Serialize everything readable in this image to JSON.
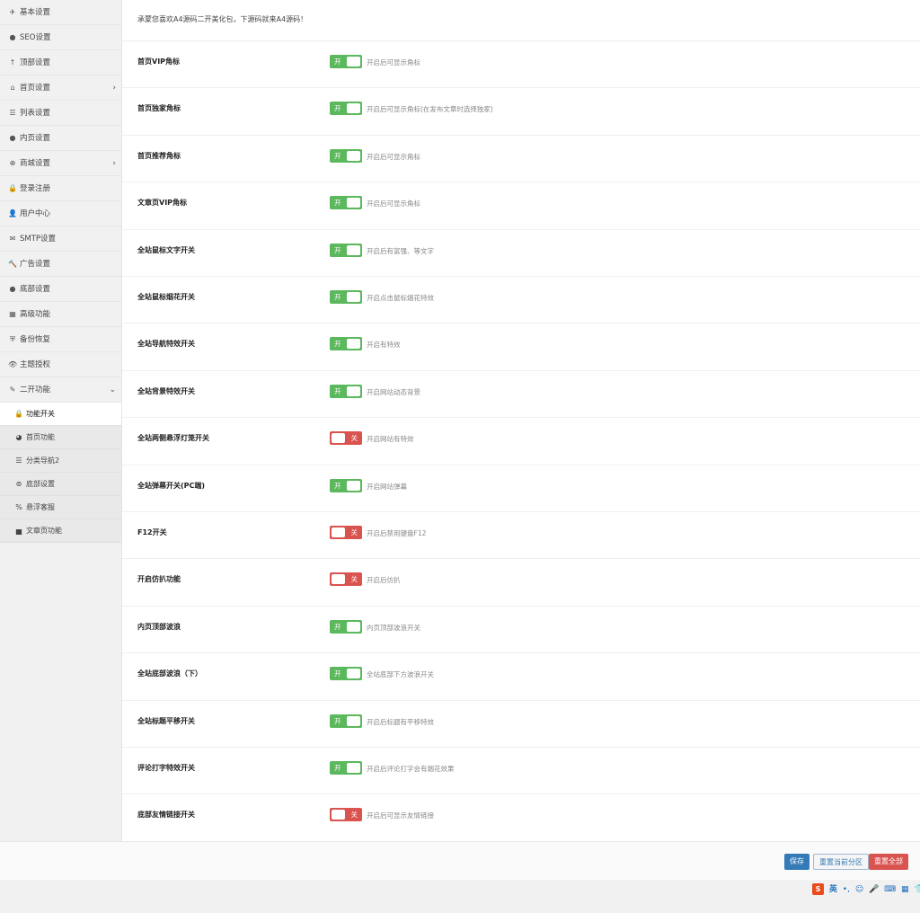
{
  "sidebar": {
    "items": [
      {
        "label": "基本设置",
        "icon": "✈"
      },
      {
        "label": "SEO设置",
        "icon": "●"
      },
      {
        "label": "顶部设置",
        "icon": "↑"
      },
      {
        "label": "首页设置",
        "icon": "⌂",
        "chevron": "›"
      },
      {
        "label": "列表设置",
        "icon": "☰"
      },
      {
        "label": "内页设置",
        "icon": "●"
      },
      {
        "label": "商城设置",
        "icon": "⊕",
        "chevron": "›"
      },
      {
        "label": "登录注册",
        "icon": "🔒"
      },
      {
        "label": "用户中心",
        "icon": "👤"
      },
      {
        "label": "SMTP设置",
        "icon": "✉"
      },
      {
        "label": "广告设置",
        "icon": "🔨"
      },
      {
        "label": "底部设置",
        "icon": "●"
      },
      {
        "label": "高级功能",
        "icon": "▦"
      },
      {
        "label": "备份恢复",
        "icon": "⛨"
      },
      {
        "label": "主题授权",
        "icon": "👁"
      },
      {
        "label": "二开功能",
        "icon": "✎",
        "chevron": "⌄"
      }
    ],
    "sub_items": [
      {
        "label": "功能开关",
        "icon": "🔒"
      },
      {
        "label": "首页功能",
        "icon": "◕"
      },
      {
        "label": "分类导航2",
        "icon": "☰"
      },
      {
        "label": "底部设置",
        "icon": "⊚"
      },
      {
        "label": "悬浮客服",
        "icon": "%"
      },
      {
        "label": "文章页功能",
        "icon": "▅"
      }
    ]
  },
  "main": {
    "welcome": "承蒙您喜欢A4源码二开美化包，下源码就来A4源码！",
    "rows": [
      {
        "label": "首页VIP角标",
        "state": "开",
        "desc": "开启后可显示角标"
      },
      {
        "label": "首页独家角标",
        "state": "开",
        "desc": "开启后可显示角标(在发布文章时选择独家)"
      },
      {
        "label": "首页推荐角标",
        "state": "开",
        "desc": "开启后可显示角标"
      },
      {
        "label": "文章页VIP角标",
        "state": "开",
        "desc": "开启后可显示角标"
      },
      {
        "label": "全站鼠标文字开关",
        "state": "开",
        "desc": "开启后有富强、等文字"
      },
      {
        "label": "全站鼠标烟花开关",
        "state": "开",
        "desc": "开启点击鼠标烟花特效"
      },
      {
        "label": "全站导航特效开关",
        "state": "开",
        "desc": "开启有特效"
      },
      {
        "label": "全站背景特效开关",
        "state": "开",
        "desc": "开启网站动态背景"
      },
      {
        "label": "全站两侧悬浮灯笼开关",
        "state": "关",
        "desc": "开启网站有特效"
      },
      {
        "label": "全站弹幕开关(PC端)",
        "state": "开",
        "desc": "开启网站弹幕"
      },
      {
        "label": "F12开关",
        "state": "关",
        "desc": "开启后禁用键盘F12"
      },
      {
        "label": "开启仿扒功能",
        "state": "关",
        "desc": "开启后仿扒"
      },
      {
        "label": "内页顶部波浪",
        "state": "开",
        "desc": "内页顶部波浪开关"
      },
      {
        "label": "全站底部波浪（下）",
        "state": "开",
        "desc": "全站底部下方波浪开关"
      },
      {
        "label": "全站标题平移开关",
        "state": "开",
        "desc": "开启后标题有平移特效"
      },
      {
        "label": "评论打字特效开关",
        "state": "开",
        "desc": "开启后评论打字会有烟花效果"
      },
      {
        "label": "底部友情链接开关",
        "state": "关",
        "desc": "开启后可显示友情链接"
      }
    ]
  },
  "footer": {
    "save": "保存",
    "reset_section": "重置当前分区",
    "reset_all": "重置全部"
  },
  "tray": {
    "ime_logo": "S",
    "lang": "英",
    "icons": [
      "punctuation-icon",
      "emoji-icon",
      "mic-icon",
      "keyboard-icon",
      "grid-icon",
      "skin-icon",
      "menu-icon"
    ]
  },
  "colors": {
    "on": "#5cb85c",
    "off": "#d9534f",
    "primary": "#337ab7"
  }
}
